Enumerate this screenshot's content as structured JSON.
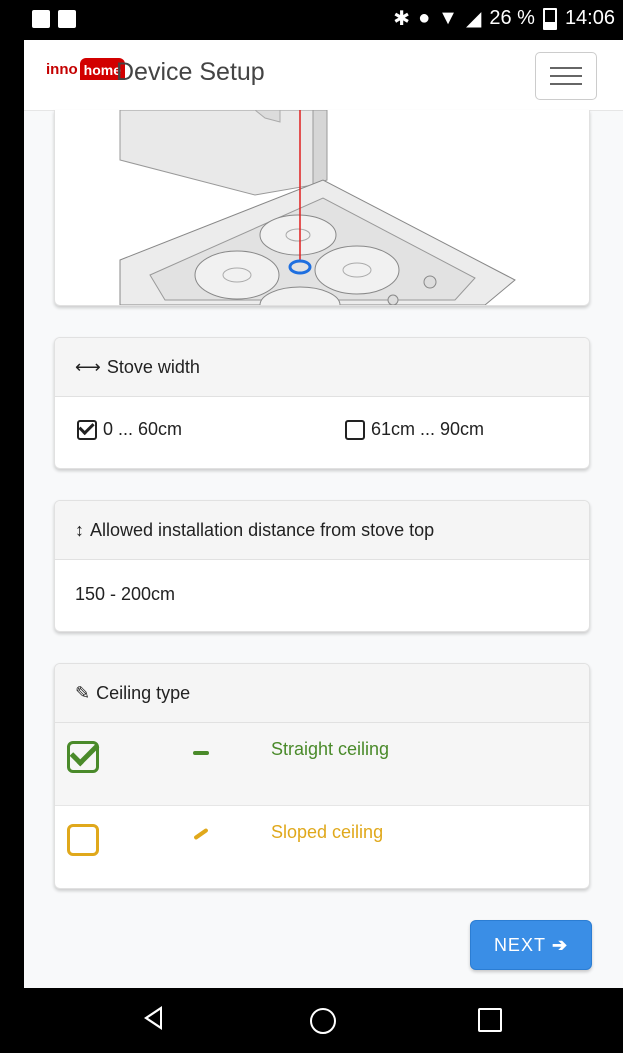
{
  "status_bar": {
    "battery": "26 %",
    "time": "14:06"
  },
  "app_bar": {
    "logo_inno": "inno",
    "logo_home": "home",
    "title": "Device Setup"
  },
  "stove_width": {
    "header": "Stove width",
    "options": [
      {
        "label": "0 ... 60cm",
        "checked": true
      },
      {
        "label": "61cm ... 90cm",
        "checked": false
      }
    ]
  },
  "distance": {
    "header": "Allowed installation distance from stove top",
    "value": "150 - 200cm"
  },
  "ceiling": {
    "header": "Ceiling type",
    "options": [
      {
        "label": "Straight ceiling",
        "checked": true,
        "color": "#4a8a2a"
      },
      {
        "label": "Sloped ceiling",
        "checked": false,
        "color": "#e0a81b"
      }
    ]
  },
  "next_label": "NEXT",
  "colors": {
    "primary": "#3a8ee6",
    "brand": "#d20000",
    "detector_ring": "#1e6fe0",
    "laser": "#e02020"
  }
}
